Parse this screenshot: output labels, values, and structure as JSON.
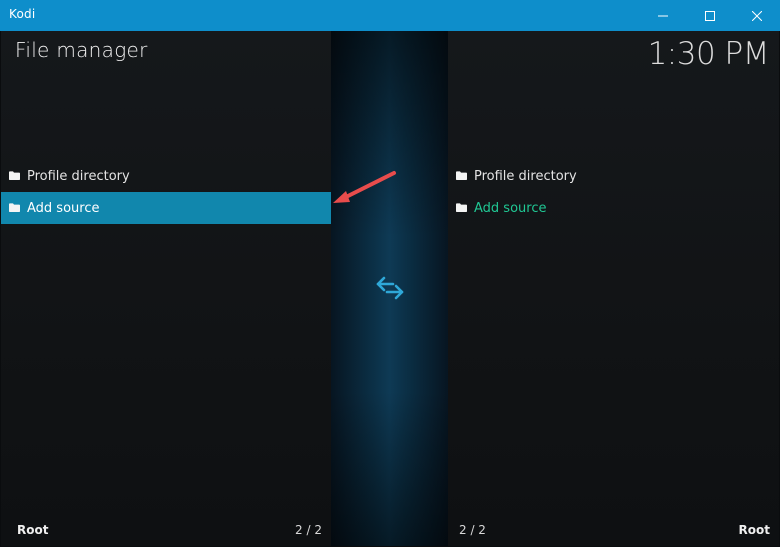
{
  "window": {
    "title": "Kodi",
    "controls": [
      "minimize-icon",
      "maximize-icon",
      "close-icon"
    ]
  },
  "header": {
    "title": "File manager",
    "clock": "1:30 PM"
  },
  "left_pane": {
    "items": [
      {
        "label": "Profile directory",
        "icon": "folder-icon"
      },
      {
        "label": "Add source",
        "icon": "folder-icon",
        "focused": true
      }
    ],
    "footer_path": "Root",
    "footer_count": "2 / 2"
  },
  "right_pane": {
    "items": [
      {
        "label": "Profile directory",
        "icon": "folder-icon"
      },
      {
        "label": "Add source",
        "icon": "folder-icon"
      }
    ],
    "footer_count": "2 / 2",
    "footer_path": "Root"
  },
  "center": {
    "icon": "swap-arrows-icon"
  },
  "colors": {
    "titlebar": "#0e8ecb",
    "focus_highlight": "#1187ad",
    "accent_text": "#20c794",
    "annotation_arrow": "#e84c4c"
  }
}
